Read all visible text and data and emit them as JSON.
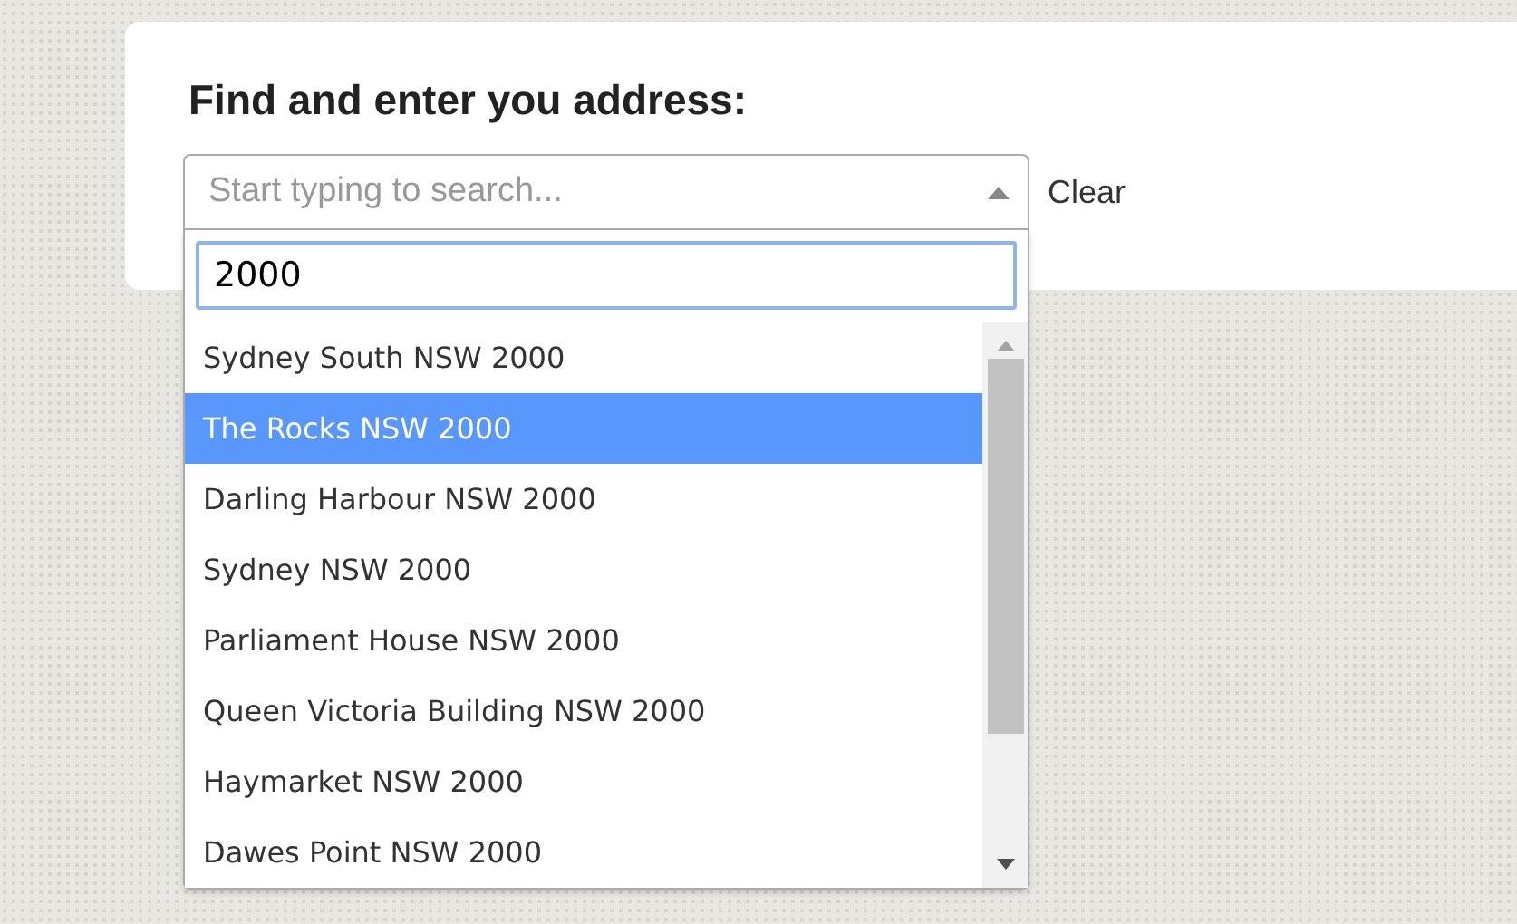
{
  "heading": "Find and enter you address:",
  "select": {
    "placeholder": "Start typing to search...",
    "expanded": true
  },
  "clear_link": "Clear",
  "search": {
    "value": "2000"
  },
  "options": [
    {
      "label": "Sydney South NSW 2000",
      "selected": false
    },
    {
      "label": "The Rocks NSW 2000",
      "selected": true
    },
    {
      "label": "Darling Harbour NSW 2000",
      "selected": false
    },
    {
      "label": "Sydney NSW 2000",
      "selected": false
    },
    {
      "label": "Parliament House NSW 2000",
      "selected": false
    },
    {
      "label": "Queen Victoria Building NSW 2000",
      "selected": false
    },
    {
      "label": "Haymarket NSW 2000",
      "selected": false
    },
    {
      "label": "Dawes Point NSW 2000",
      "selected": false
    }
  ]
}
